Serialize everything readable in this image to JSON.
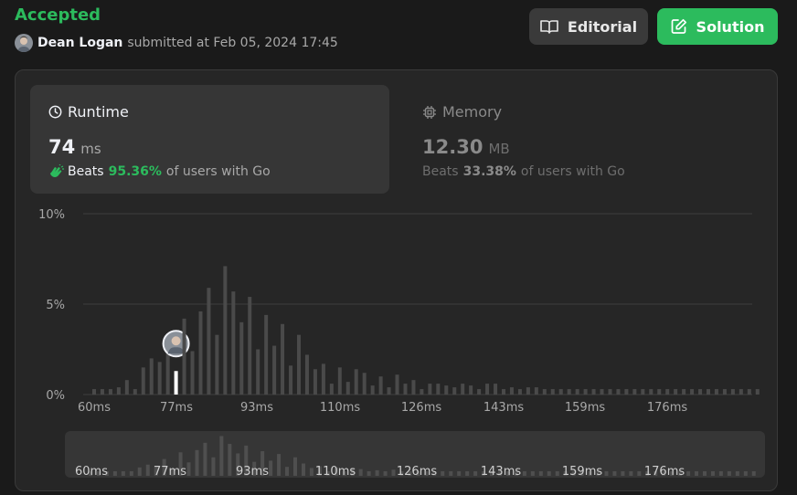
{
  "status": "Accepted",
  "submission": {
    "user": "Dean Logan",
    "submitted_text": "submitted at Feb 05, 2024 17:45"
  },
  "buttons": {
    "editorial": "Editorial",
    "solution": "Solution"
  },
  "runtime": {
    "title": "Runtime",
    "value": "74",
    "unit": "ms",
    "beats_label": "Beats",
    "beats_pct": "95.36%",
    "beats_suffix": "of users with Go"
  },
  "memory": {
    "title": "Memory",
    "value": "12.30",
    "unit": "MB",
    "beats_label": "Beats",
    "beats_pct": "33.38%",
    "beats_suffix": "of users with Go"
  },
  "colors": {
    "accepted": "#2cbb5d",
    "bar": "#4a4a4a",
    "highlight": "#ffffff"
  },
  "chart_data": {
    "type": "bar",
    "y_ticks": [
      "10%",
      "5%",
      "0%"
    ],
    "ylim": [
      0,
      10
    ],
    "x_ticks": [
      "60ms",
      "77ms",
      "93ms",
      "110ms",
      "126ms",
      "143ms",
      "159ms",
      "176ms"
    ],
    "highlight_index": 10,
    "values": [
      0.3,
      0.3,
      0.3,
      0.4,
      0.8,
      0.3,
      1.5,
      2.0,
      1.8,
      3.0,
      1.3,
      4.2,
      2.4,
      4.6,
      5.9,
      3.3,
      7.1,
      5.7,
      4.0,
      5.4,
      2.5,
      4.4,
      2.7,
      3.9,
      1.6,
      3.3,
      2.2,
      1.4,
      1.7,
      0.6,
      1.5,
      0.7,
      1.4,
      1.2,
      0.5,
      1.0,
      0.4,
      1.1,
      0.6,
      0.8,
      0.3,
      0.6,
      0.6,
      0.5,
      0.4,
      0.6,
      0.5,
      0.3,
      0.6,
      0.6,
      0.3,
      0.4,
      0.3,
      0.4,
      0.4,
      0.3,
      0.3,
      0.3,
      0.3,
      0.3,
      0.3,
      0.3,
      0.3,
      0.3,
      0.3,
      0.3,
      0.3,
      0.3,
      0.3,
      0.3,
      0.3,
      0.3,
      0.3,
      0.3,
      0.3,
      0.3,
      0.3,
      0.3,
      0.3,
      0.3,
      0.3,
      0.3
    ]
  },
  "minimap": {
    "x_ticks": [
      "60ms",
      "77ms",
      "93ms",
      "110ms",
      "126ms",
      "143ms",
      "159ms",
      "176ms"
    ]
  }
}
